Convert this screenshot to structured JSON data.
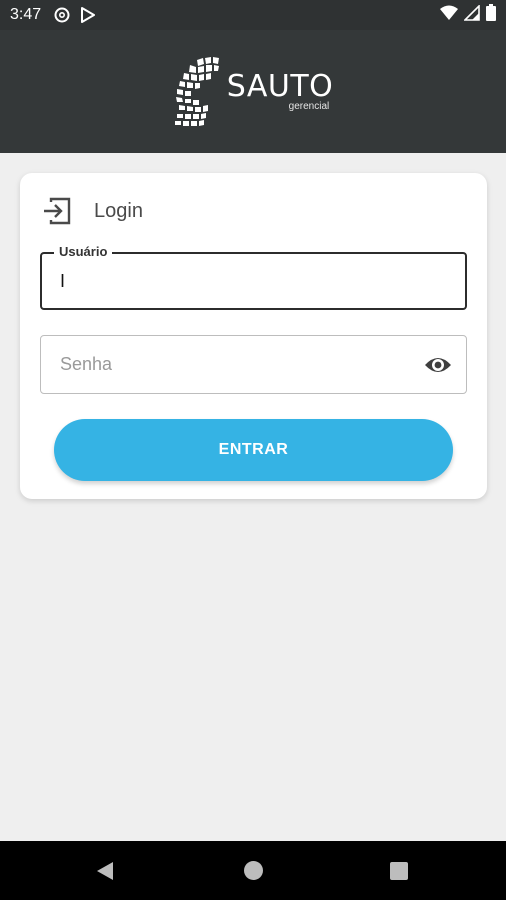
{
  "status_bar": {
    "time": "3:47",
    "left_icons": [
      "at-sign-icon",
      "play-store-icon"
    ],
    "right_icons": [
      "wifi-icon",
      "signal-icon",
      "battery-icon"
    ]
  },
  "header": {
    "logo_name": "SAUTO",
    "logo_sub": "gerencial",
    "background": "#343839"
  },
  "login_card": {
    "title": "Login",
    "title_icon": "login-icon",
    "username": {
      "label": "Usuário",
      "value": "I"
    },
    "password": {
      "placeholder": "Senha",
      "toggle_icon": "eye-icon"
    },
    "submit_label": "ENTRAR",
    "accent": "#35b3e4"
  },
  "nav_bar": {
    "buttons": [
      "back-icon",
      "home-icon",
      "recents-icon"
    ]
  }
}
